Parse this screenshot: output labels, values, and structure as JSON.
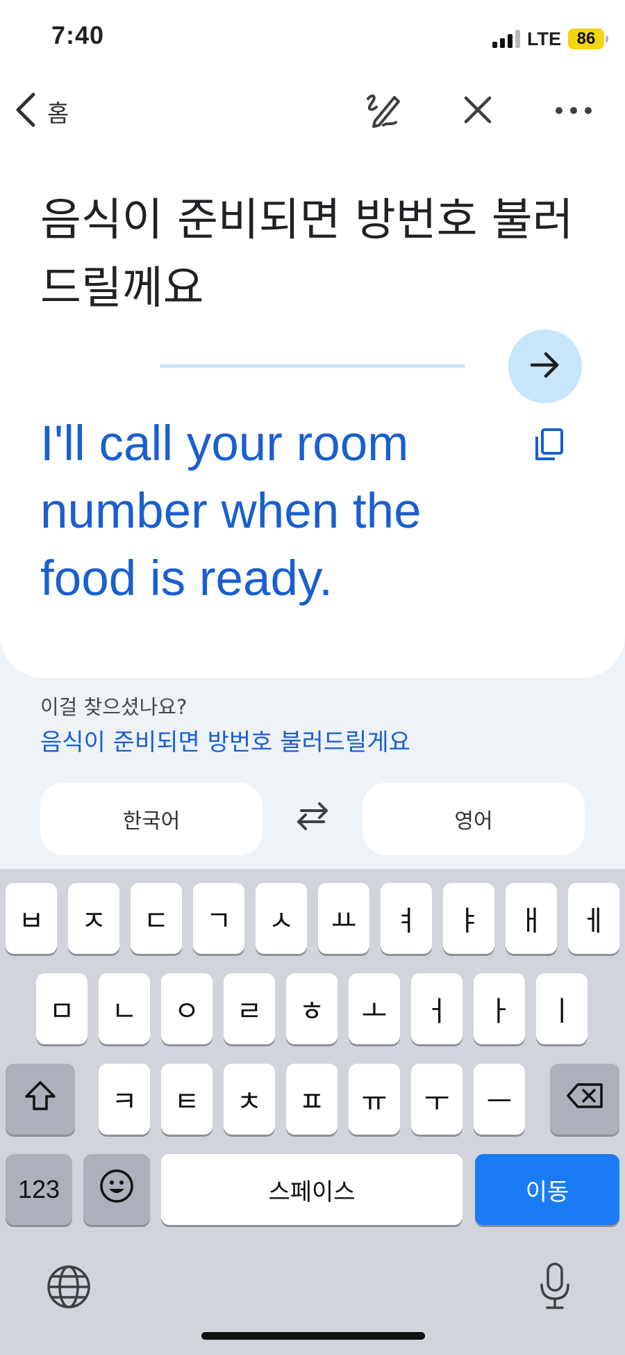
{
  "status_bar": {
    "time": "7:40",
    "network": "LTE",
    "battery": "86"
  },
  "header": {
    "back_label": "홈",
    "icons": [
      "handwriting-icon",
      "close-icon",
      "more-icon"
    ]
  },
  "source_text": "음식이 준비되면 방번호 불러드릴께요",
  "translation": "I'll call your room number when the food is ready.",
  "suggestion": {
    "label": "이걸 찾으셨나요?",
    "text": "음식이 준비되면 방번호 불러드릴게요"
  },
  "languages": {
    "source": "한국어",
    "target": "영어"
  },
  "colors": {
    "accent": "#1a5fce",
    "enter_key": "#1a7cf5",
    "go_button": "#c7e5fb"
  },
  "keyboard": {
    "row1": [
      "ㅂ",
      "ㅈ",
      "ㄷ",
      "ㄱ",
      "ㅅ",
      "ㅛ",
      "ㅕ",
      "ㅑ",
      "ㅐ",
      "ㅔ"
    ],
    "row2": [
      "ㅁ",
      "ㄴ",
      "ㅇ",
      "ㄹ",
      "ㅎ",
      "ㅗ",
      "ㅓ",
      "ㅏ",
      "ㅣ"
    ],
    "row3": [
      "ㅋ",
      "ㅌ",
      "ㅊ",
      "ㅍ",
      "ㅠ",
      "ㅜ",
      "ㅡ"
    ],
    "numbers_label": "123",
    "space_label": "스페이스",
    "enter_label": "이동"
  }
}
